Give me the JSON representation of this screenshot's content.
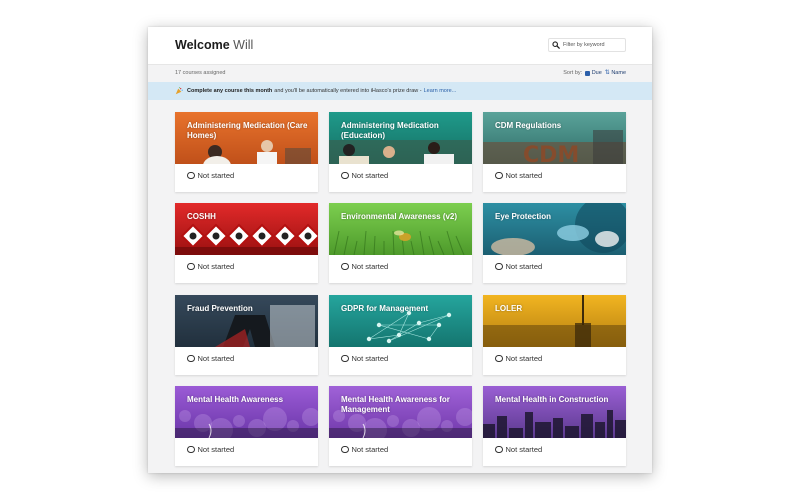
{
  "header": {
    "welcome": "Welcome",
    "user_name": "Will",
    "search_placeholder": "Filter by keyword"
  },
  "subbar": {
    "courses_assigned": "17 courses assigned",
    "sort_label": "Sort by:",
    "sort_options": [
      "Due",
      "Name"
    ]
  },
  "banner": {
    "bold_text": "Complete any course this month",
    "text": "and you'll be automatically entered into iHasco's prize draw -",
    "link": "Learn more..."
  },
  "status_text": "Not started",
  "courses": [
    {
      "title": "Administering Medication (Care Homes)",
      "colors": [
        "#e8732c",
        "#c0501a"
      ],
      "icon": "care-home-staff-image"
    },
    {
      "title": "Administering Medication (Education)",
      "colors": [
        "#1f9a8a",
        "#166f64"
      ],
      "icon": "classroom-image"
    },
    {
      "title": "CDM Regulations",
      "colors": [
        "#5aa39a",
        "#2f6d67"
      ],
      "icon": "cdm-letters-image"
    },
    {
      "title": "COSHH",
      "colors": [
        "#e22a2a",
        "#9b1010"
      ],
      "icon": "hazard-symbols-image"
    },
    {
      "title": "Environmental Awareness (v2)",
      "colors": [
        "#7ccf4f",
        "#4e9a2b"
      ],
      "icon": "insect-on-grass-image"
    },
    {
      "title": "Eye Protection",
      "colors": [
        "#2d8fa3",
        "#1c5f72"
      ],
      "icon": "safety-goggles-image"
    },
    {
      "title": "Fraud Prevention",
      "colors": [
        "#3b4f63",
        "#1d2b38"
      ],
      "icon": "walking-person-image"
    },
    {
      "title": "GDPR for Management",
      "colors": [
        "#25a59d",
        "#14756f"
      ],
      "icon": "network-nodes-image"
    },
    {
      "title": "LOLER",
      "colors": [
        "#f2b521",
        "#b47e10"
      ],
      "icon": "lifting-equipment-image"
    },
    {
      "title": "Mental Health Awareness",
      "colors": [
        "#9b5bd6",
        "#6a36a8"
      ],
      "icon": "abstract-bokeh-image"
    },
    {
      "title": "Mental Health Awareness for Management",
      "colors": [
        "#a062d8",
        "#7038aa"
      ],
      "icon": "abstract-bokeh-image"
    },
    {
      "title": "Mental Health in Construction",
      "colors": [
        "#9a5fd4",
        "#5c3a8f"
      ],
      "icon": "city-skyline-image"
    }
  ]
}
